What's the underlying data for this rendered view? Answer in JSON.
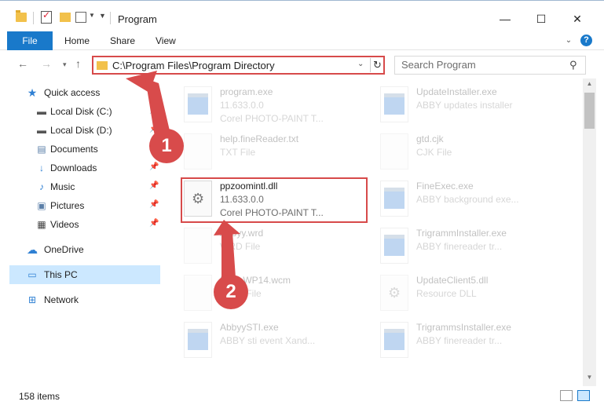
{
  "window": {
    "title": "Program"
  },
  "ribbon": {
    "tabs": [
      "File",
      "Home",
      "Share",
      "View"
    ]
  },
  "address": {
    "path": "C:\\Program Files\\Program Directory"
  },
  "search": {
    "placeholder": "Search Program"
  },
  "sidebar": {
    "items": [
      {
        "label": "Quick access",
        "icon": "star-icon"
      },
      {
        "label": "Local Disk (C:)",
        "icon": "drive-icon"
      },
      {
        "label": "Local Disk (D:)",
        "icon": "drive-icon"
      },
      {
        "label": "Documents",
        "icon": "documents-icon"
      },
      {
        "label": "Downloads",
        "icon": "download-arrow-icon"
      },
      {
        "label": "Music",
        "icon": "music-note-icon"
      },
      {
        "label": "Pictures",
        "icon": "pictures-icon"
      },
      {
        "label": "Videos",
        "icon": "film-icon"
      },
      {
        "label": "OneDrive",
        "icon": "cloud-icon"
      },
      {
        "label": "This PC",
        "icon": "monitor-icon"
      },
      {
        "label": "Network",
        "icon": "network-icon"
      }
    ]
  },
  "files": {
    "left": [
      {
        "name": "program.exe",
        "line1": "11.633.0.0",
        "line2": "Corel PHOTO-PAINT T..."
      },
      {
        "name": "help.fineReader.txt",
        "line1": "TXT File",
        "line2": ""
      },
      {
        "name": "ppzoomintl.dll",
        "line1": "11.633.0.0",
        "line2": "Corel PHOTO-PAINT T..."
      },
      {
        "name": "Abbyy.wrd",
        "line1": "WRD File",
        "line2": ""
      },
      {
        "name": "BasicWP14.wcm",
        "line1": "WCM File",
        "line2": ""
      },
      {
        "name": "AbbyySTI.exe",
        "line1": "ABBY sti event Xand...",
        "line2": ""
      }
    ],
    "right": [
      {
        "name": "UpdateInstaller.exe",
        "line1": "ABBY updates installer",
        "line2": ""
      },
      {
        "name": "gtd.cjk",
        "line1": "CJK File",
        "line2": ""
      },
      {
        "name": "FineExec.exe",
        "line1": "ABBY background exe...",
        "line2": ""
      },
      {
        "name": "TrigrammInstaller.exe",
        "line1": "ABBY finereader tr...",
        "line2": ""
      },
      {
        "name": "UpdateClient5.dll",
        "line1": "Resource DLL",
        "line2": ""
      },
      {
        "name": "TrigrammsInstaller.exe",
        "line1": "ABBY finereader tr...",
        "line2": ""
      }
    ]
  },
  "annotations": {
    "step1": "1",
    "step2": "2",
    "accent": "#d84b4b"
  },
  "status": {
    "items": "158 items"
  }
}
